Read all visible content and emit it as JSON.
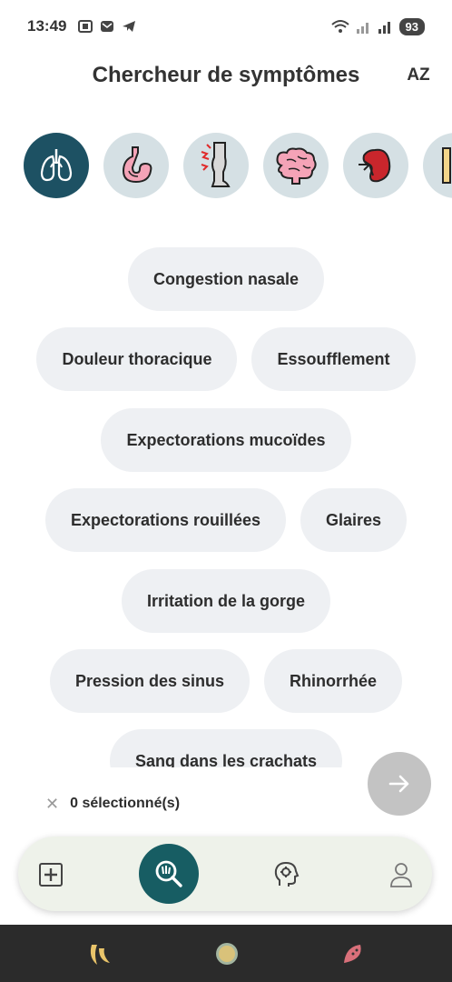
{
  "status_bar": {
    "time": "13:49",
    "battery": "93"
  },
  "header": {
    "title": "Chercheur de symptômes",
    "sort_label": "AZ"
  },
  "categories": [
    {
      "icon": "lungs-icon",
      "active": true
    },
    {
      "icon": "stomach-icon",
      "active": false
    },
    {
      "icon": "leg-pain-icon",
      "active": false
    },
    {
      "icon": "brain-icon",
      "active": false
    },
    {
      "icon": "kidney-icon",
      "active": false
    },
    {
      "icon": "partial-icon",
      "active": false
    }
  ],
  "symptoms": {
    "row1": [
      "Congestion nasale"
    ],
    "row2": [
      "Douleur thoracique",
      "Essoufflement"
    ],
    "row3": [
      "Expectorations mucoïdes"
    ],
    "row4": [
      "Expectorations rouillées",
      "Glaires"
    ],
    "row5": [
      "Irritation de la gorge"
    ],
    "row6": [
      "Pression des sinus",
      "Rhinorrhée"
    ],
    "row7": [
      "Sang dans les crachats"
    ]
  },
  "selection": {
    "count_label": "0 sélectionné(s)"
  },
  "bottom_nav": {
    "items": [
      "add-icon",
      "symptom-search-icon",
      "head-gear-icon",
      "profile-icon"
    ]
  },
  "colors": {
    "accent": "#175d63",
    "active_category": "#1d5163",
    "category_bg": "#d5e0e4",
    "chip_bg": "#eef0f3",
    "fab_disabled": "#c3c3c3",
    "nav_bg": "#eef2ea"
  }
}
